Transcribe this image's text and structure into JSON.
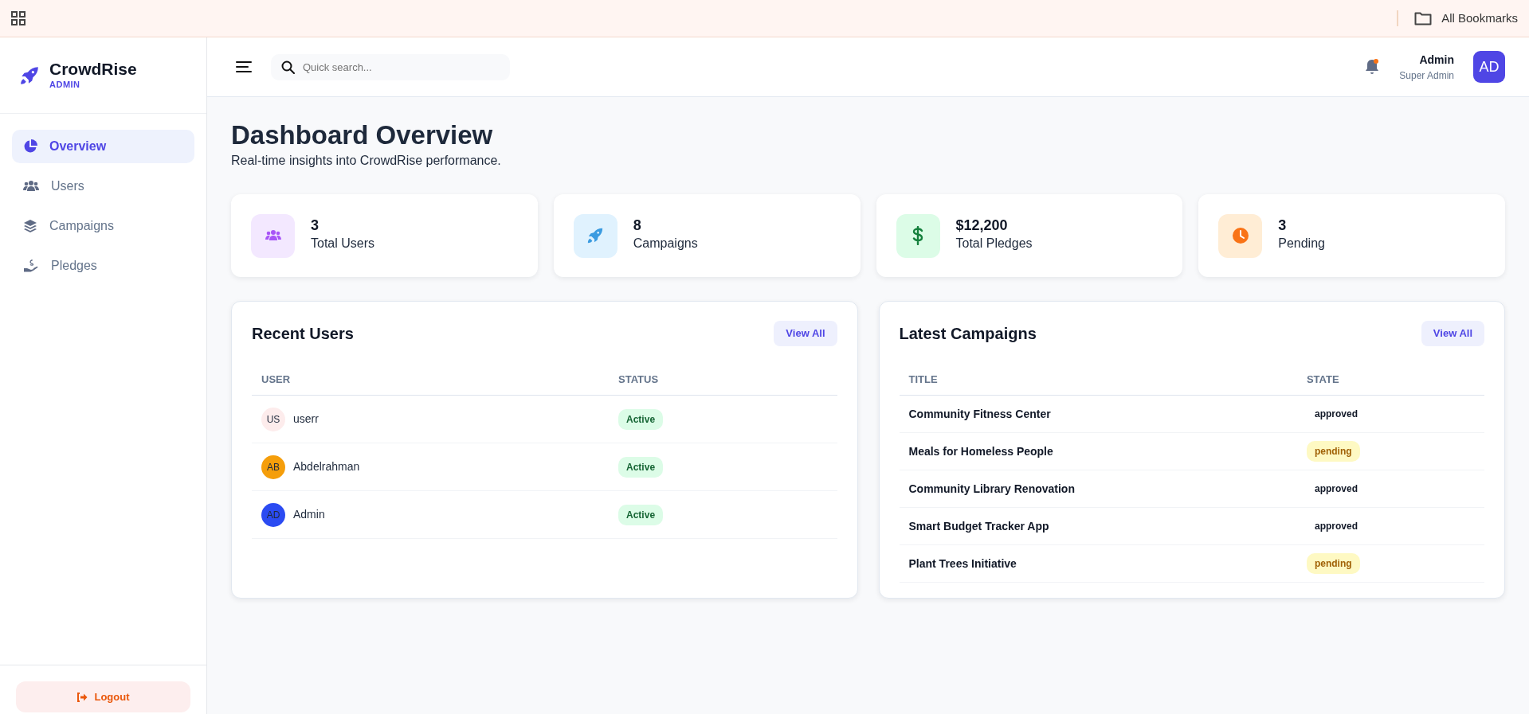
{
  "bookmarks_bar": {
    "folder": "All Bookmarks"
  },
  "sidebar": {
    "brand": "CrowdRise",
    "role": "ADMIN",
    "items": [
      {
        "label": "Overview",
        "selected": true
      },
      {
        "label": "Users",
        "selected": false
      },
      {
        "label": "Campaigns",
        "selected": false
      },
      {
        "label": "Pledges",
        "selected": false
      }
    ],
    "logout": "Logout"
  },
  "header": {
    "search": {
      "placeholder": "Quick search..."
    },
    "notifications": {
      "unread": true
    },
    "user": {
      "name": "Admin",
      "role": "Super Admin",
      "initials": "AD"
    }
  },
  "page": {
    "title": "Dashboard Overview",
    "subtitle": "Real-time insights into CrowdRise performance."
  },
  "stats": [
    {
      "value": "3",
      "label": "Total Users"
    },
    {
      "value": "8",
      "label": "Campaigns"
    },
    {
      "value": "$12,200",
      "label": "Total Pledges"
    },
    {
      "value": "3",
      "label": "Pending"
    }
  ],
  "recent_users": {
    "title": "Recent Users",
    "button": "View All",
    "columns": [
      "USER",
      "STATUS"
    ],
    "rows": [
      {
        "initials": "US",
        "name": "userr",
        "status": "Active",
        "color": "#fdecec"
      },
      {
        "initials": "AB",
        "name": "Abdelrahman",
        "status": "Active",
        "color": "#f59e0b"
      },
      {
        "initials": "AD",
        "name": "Admin",
        "status": "Active",
        "color": "#2b4bf2"
      }
    ]
  },
  "latest_campaigns": {
    "title": "Latest Campaigns",
    "button": "View All",
    "columns": [
      "TITLE",
      "STATE"
    ],
    "rows": [
      {
        "title": "Community Fitness Center",
        "state": "approved",
        "highlighted": false
      },
      {
        "title": "Meals for Homeless People",
        "state": "pending",
        "highlighted": true
      },
      {
        "title": "Community Library Renovation",
        "state": "approved",
        "highlighted": false
      },
      {
        "title": "Smart Budget Tracker App",
        "state": "approved",
        "highlighted": false
      },
      {
        "title": "Plant Trees Initiative",
        "state": "pending",
        "highlighted": true
      }
    ]
  }
}
